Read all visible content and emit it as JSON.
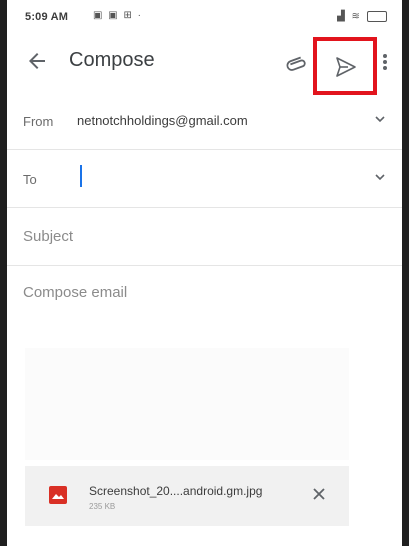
{
  "status_bar": {
    "time": "5:09 AM",
    "left_icons": [
      "image-icon",
      "image-icon",
      "grid-icon",
      "dot-icon"
    ],
    "right_icons": [
      "signal-icon",
      "wifi-icon",
      "battery-icon"
    ]
  },
  "app_bar": {
    "title": "Compose",
    "icons": [
      "back-arrow-icon",
      "attach-icon",
      "send-icon",
      "more-vert-icon"
    ],
    "highlight_color": "#e2141d"
  },
  "from": {
    "label": "From",
    "value": "netnotchholdings@gmail.com"
  },
  "to": {
    "label": "To",
    "value": ""
  },
  "subject": {
    "placeholder": "Subject"
  },
  "body": {
    "placeholder": "Compose email"
  },
  "attachment": {
    "file_name": "Screenshot_20....android.gm.jpg",
    "file_size": "235 KB",
    "icon": "image-file-icon",
    "icon_color": "#d93025"
  }
}
